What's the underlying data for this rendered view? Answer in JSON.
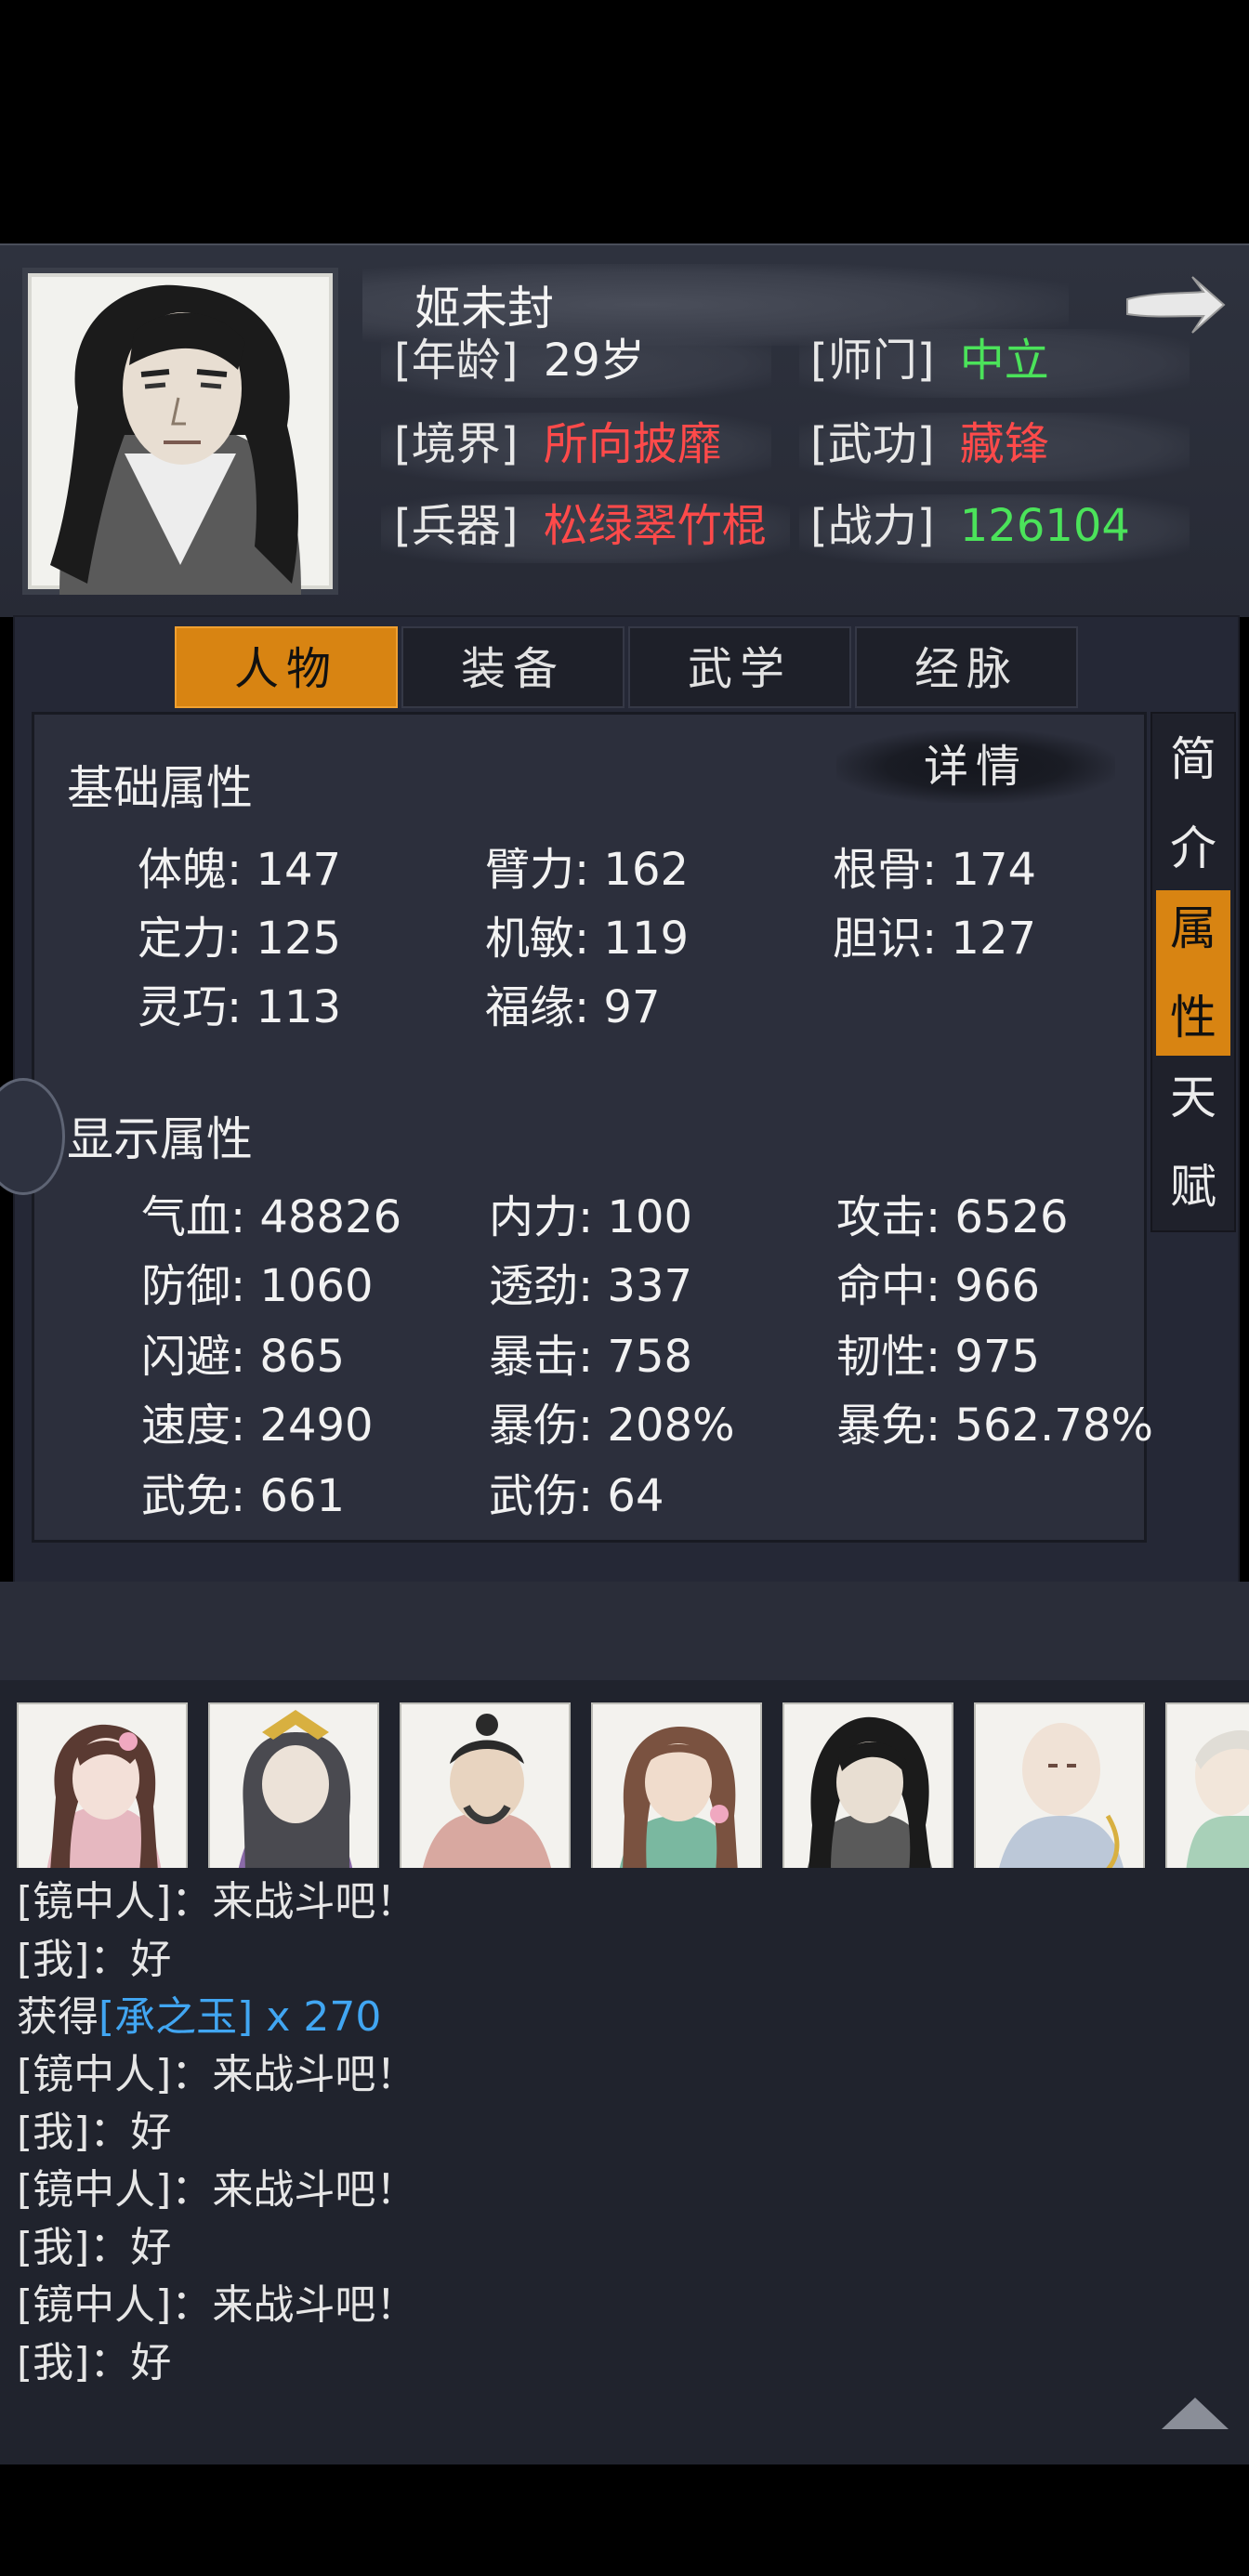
{
  "header": {
    "name": "姬未封",
    "next_icon": "right-arrow-icon",
    "rows": [
      [
        {
          "label": "[年龄]",
          "value": "29岁",
          "color": "#f2f2f2"
        },
        {
          "label": "[师门]",
          "value": "中立",
          "color": "#4be35a"
        }
      ],
      [
        {
          "label": "[境界]",
          "value": "所向披靡",
          "color": "#ff4a4a"
        },
        {
          "label": "[武功]",
          "value": "藏锋",
          "color": "#ff4a4a"
        }
      ],
      [
        {
          "label": "[兵器]",
          "value": "松绿翠竹棍",
          "color": "#ff4a4a"
        },
        {
          "label": "[战力]",
          "value": "126104",
          "color": "#4be35a"
        }
      ]
    ]
  },
  "tabs": [
    {
      "label": "人物",
      "active": true
    },
    {
      "label": "装备",
      "active": false
    },
    {
      "label": "武学",
      "active": false
    },
    {
      "label": "经脉",
      "active": false
    }
  ],
  "side_tabs": [
    {
      "label": "简介",
      "active": false
    },
    {
      "label": "属性",
      "active": true
    },
    {
      "label": "天赋",
      "active": false
    }
  ],
  "detail_button": "详情",
  "base_section": {
    "title": "基础属性",
    "stats": [
      "体魄: 147",
      "臂力: 162",
      "根骨: 174",
      "定力: 125",
      "机敏: 119",
      "胆识: 127",
      "灵巧: 113",
      "福缘: 97"
    ]
  },
  "display_section": {
    "title": "显示属性",
    "stats": [
      "气血: 48826",
      "内力: 100",
      "攻击: 6526",
      "防御: 1060",
      "透劲: 337",
      "命中: 966",
      "闪避: 865",
      "暴击: 758",
      "韧性: 975",
      "速度: 2490",
      "暴伤: 208%",
      "暴免: 562.78%",
      "武免: 661",
      "武伤: 64"
    ]
  },
  "party": [
    "member-1",
    "member-2",
    "member-3",
    "member-4",
    "member-5",
    "member-6",
    "member-7"
  ],
  "chat": [
    {
      "parts": [
        {
          "t": "[镜中人]：来战斗吧！",
          "c": "n"
        }
      ]
    },
    {
      "parts": [
        {
          "t": "[我]：好",
          "c": "n"
        }
      ]
    },
    {
      "parts": [
        {
          "t": "获得",
          "c": "n"
        },
        {
          "t": "[承之玉] x 270",
          "c": "b"
        }
      ]
    },
    {
      "parts": [
        {
          "t": "[镜中人]：来战斗吧！",
          "c": "n"
        }
      ]
    },
    {
      "parts": [
        {
          "t": "[我]：好",
          "c": "n"
        }
      ]
    },
    {
      "parts": [
        {
          "t": "[镜中人]：来战斗吧！",
          "c": "n"
        }
      ]
    },
    {
      "parts": [
        {
          "t": "[我]：好",
          "c": "n"
        }
      ]
    },
    {
      "parts": [
        {
          "t": "[镜中人]：来战斗吧！",
          "c": "n"
        }
      ]
    },
    {
      "parts": [
        {
          "t": "[我]：好",
          "c": "n"
        }
      ]
    }
  ],
  "colors": {
    "accent": "#d88412",
    "green": "#4be35a",
    "red": "#ff4a4a",
    "link_blue": "#41a6f2"
  }
}
